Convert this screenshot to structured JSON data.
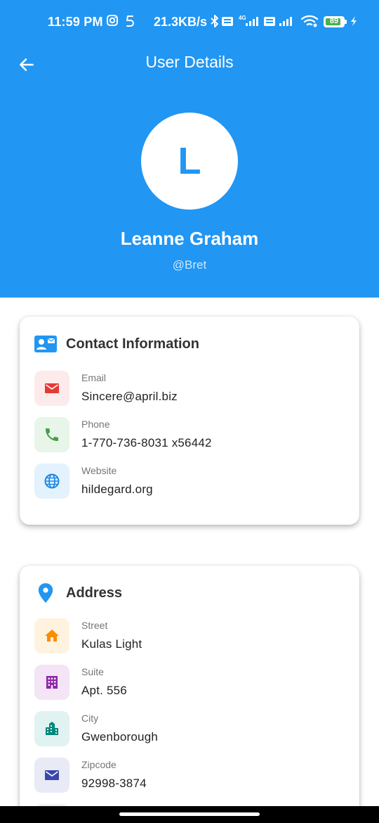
{
  "status_bar": {
    "time": "11:59 PM",
    "net_speed": "21.3KB/s",
    "battery": "89",
    "battery_level": 0.89
  },
  "header": {
    "title": "User Details",
    "avatar_letter": "L",
    "name": "Leanne Graham",
    "username": "@Bret"
  },
  "colors": {
    "primary": "#2196F3",
    "email": "#E53935",
    "phone": "#43A047",
    "website": "#1E88E5",
    "street": "#FB8C00",
    "suite": "#8E24AA",
    "city": "#00897B",
    "zipcode": "#3949AB"
  },
  "contact": {
    "title": "Contact Information",
    "icon": "contact-card-icon",
    "items": [
      {
        "label": "Email",
        "value": "Sincere@april.biz",
        "icon": "email-icon"
      },
      {
        "label": "Phone",
        "value": "1-770-736-8031 x56442",
        "icon": "phone-icon"
      },
      {
        "label": "Website",
        "value": "hildegard.org",
        "icon": "globe-icon"
      }
    ]
  },
  "address": {
    "title": "Address",
    "icon": "location-pin-icon",
    "items": [
      {
        "label": "Street",
        "value": "Kulas Light",
        "icon": "home-icon"
      },
      {
        "label": "Suite",
        "value": "Apt. 556",
        "icon": "building-icon"
      },
      {
        "label": "City",
        "value": "Gwenborough",
        "icon": "city-icon"
      },
      {
        "label": "Zipcode",
        "value": "92998-3874",
        "icon": "mail-icon"
      }
    ]
  }
}
